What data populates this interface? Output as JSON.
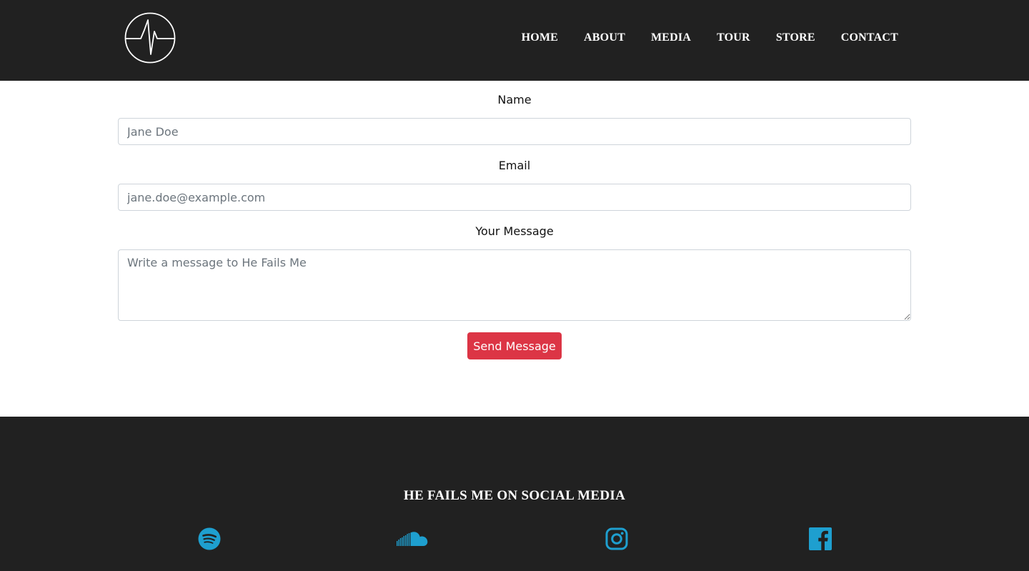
{
  "brand": {
    "logo_icon": "heartbeat-circle-logo-icon"
  },
  "nav": {
    "items": [
      {
        "label": "HOME"
      },
      {
        "label": "ABOUT"
      },
      {
        "label": "MEDIA"
      },
      {
        "label": "TOUR"
      },
      {
        "label": "STORE"
      },
      {
        "label": "CONTACT"
      }
    ]
  },
  "form": {
    "name_label": "Name",
    "name_placeholder": "Jane Doe",
    "email_label": "Email",
    "email_placeholder": "jane.doe@example.com",
    "message_label": "Your Message",
    "message_placeholder": "Write a message to He Fails Me",
    "submit_label": "Send Message"
  },
  "footer": {
    "title": "HE FAILS ME ON SOCIAL MEDIA",
    "social": [
      {
        "icon": "spotify-icon"
      },
      {
        "icon": "soundcloud-icon"
      },
      {
        "icon": "instagram-icon"
      },
      {
        "icon": "facebook-icon"
      }
    ]
  },
  "colors": {
    "header_bg": "#212121",
    "footer_bg": "#212121",
    "button_bg": "#dc3545",
    "social_icon": "#1e9fcf",
    "nav_text": "#ffffff"
  }
}
